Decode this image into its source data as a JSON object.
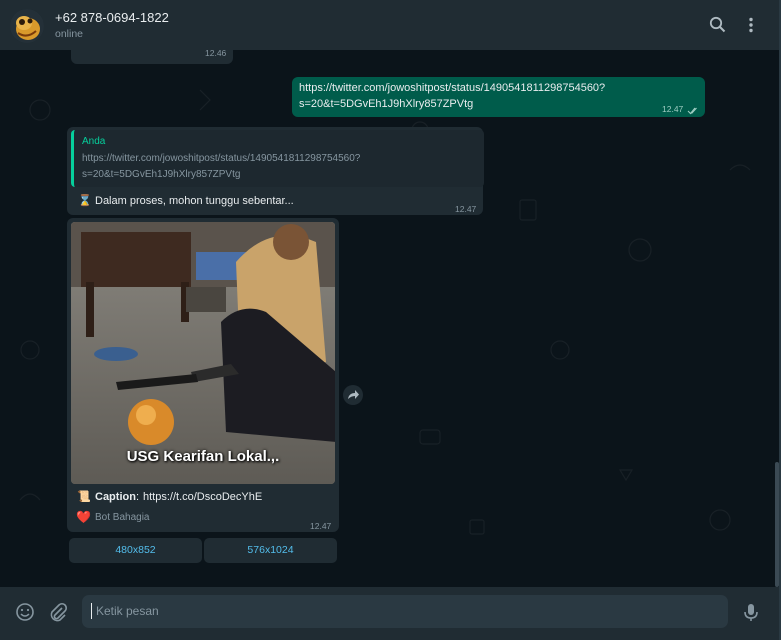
{
  "header": {
    "contact_name": "+62 878-0694-1822",
    "status": "online"
  },
  "messages": {
    "first_time": "12.46",
    "outgoing": {
      "text": "https://twitter.com/jowoshitpost/status/1490541811298754560?s=20&t=5DGvEh1J9hXlry857ZPVtg",
      "line1": "https://twitter.com/jowoshitpost/status/1490541811298754560?",
      "line2": "s=20&t=5DGvEh1J9hXlry857ZPVtg",
      "time": "12.47"
    },
    "reply": {
      "quoted_sender": "Anda",
      "quoted_line1": "https://twitter.com/jowoshitpost/status/1490541811298754560?",
      "quoted_line2": "s=20&t=5DGvEh1J9hXlry857ZPVtg",
      "text": "Dalam proses, mohon tunggu sebentar...",
      "emoji": "⌛",
      "time": "12.47"
    },
    "media": {
      "overlay_text": "USG Kearifan Lokal.,.",
      "caption_label": "Caption",
      "caption_link": "https://t.co/DscoDecYhE",
      "caption_emoji": "📜",
      "sender_label": "Bot Bahagia",
      "sender_emoji": "❤️",
      "time": "12.47"
    },
    "buttons": [
      "480x852",
      "576x1024"
    ]
  },
  "composer": {
    "placeholder": "Ketik pesan"
  },
  "colors": {
    "background": "#0b141a",
    "header": "#202c33",
    "incoming_bubble": "#202c33",
    "outgoing_bubble": "#005c4b",
    "link": "#53bdeb",
    "accent": "#06cf9c"
  },
  "icons": [
    "search-icon",
    "menu-dots-icon",
    "emoji-icon",
    "attach-icon",
    "mic-icon",
    "forward-icon",
    "double-check-icon"
  ]
}
